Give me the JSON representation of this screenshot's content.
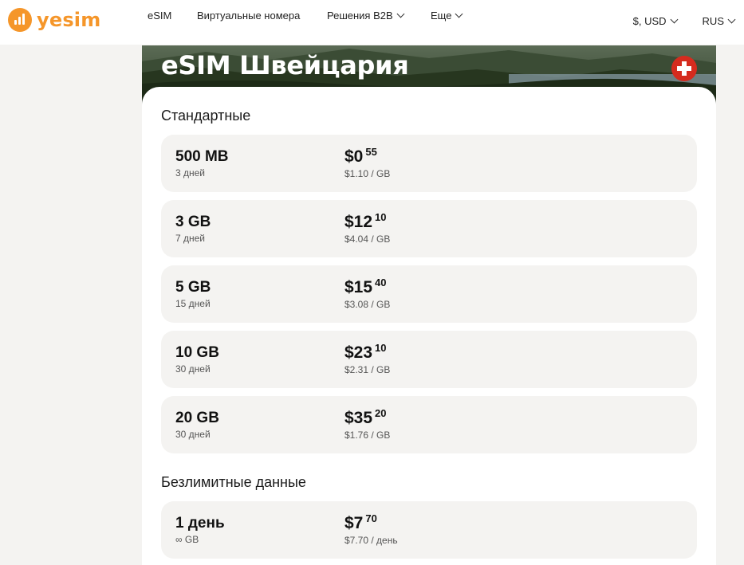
{
  "header": {
    "logo_text": "yesim",
    "nav": [
      {
        "label": "eSIM",
        "dropdown": false
      },
      {
        "label": "Виртуальные номера",
        "dropdown": false
      },
      {
        "label": "Решения B2B",
        "dropdown": true
      },
      {
        "label": "Еще",
        "dropdown": true
      }
    ],
    "currency": "$, USD",
    "language": "RUS"
  },
  "hero": {
    "title": "eSIM Швейцария",
    "flag_icon": "switzerland-flag-icon"
  },
  "sections": [
    {
      "title": "Стандартные",
      "plans": [
        {
          "amount": "500 MB",
          "period": "3 дней",
          "price_main": "$0",
          "price_cents": "55",
          "unit_price": "$1.10 / GB"
        },
        {
          "amount": "3 GB",
          "period": "7 дней",
          "price_main": "$12",
          "price_cents": "10",
          "unit_price": "$4.04 / GB"
        },
        {
          "amount": "5 GB",
          "period": "15 дней",
          "price_main": "$15",
          "price_cents": "40",
          "unit_price": "$3.08 / GB"
        },
        {
          "amount": "10 GB",
          "period": "30 дней",
          "price_main": "$23",
          "price_cents": "10",
          "unit_price": "$2.31 / GB"
        },
        {
          "amount": "20 GB",
          "period": "30 дней",
          "price_main": "$35",
          "price_cents": "20",
          "unit_price": "$1.76 / GB"
        }
      ]
    },
    {
      "title": "Безлимитные данные",
      "plans": [
        {
          "amount": "1 день",
          "period": "∞ GB",
          "price_main": "$7",
          "price_cents": "70",
          "unit_price": "$7.70 / день"
        }
      ]
    }
  ],
  "colors": {
    "brand": "#f5962a",
    "page_bg": "#f4f3f1",
    "plan_bg": "#f4f3f1",
    "flag_red": "#d52b1e"
  }
}
